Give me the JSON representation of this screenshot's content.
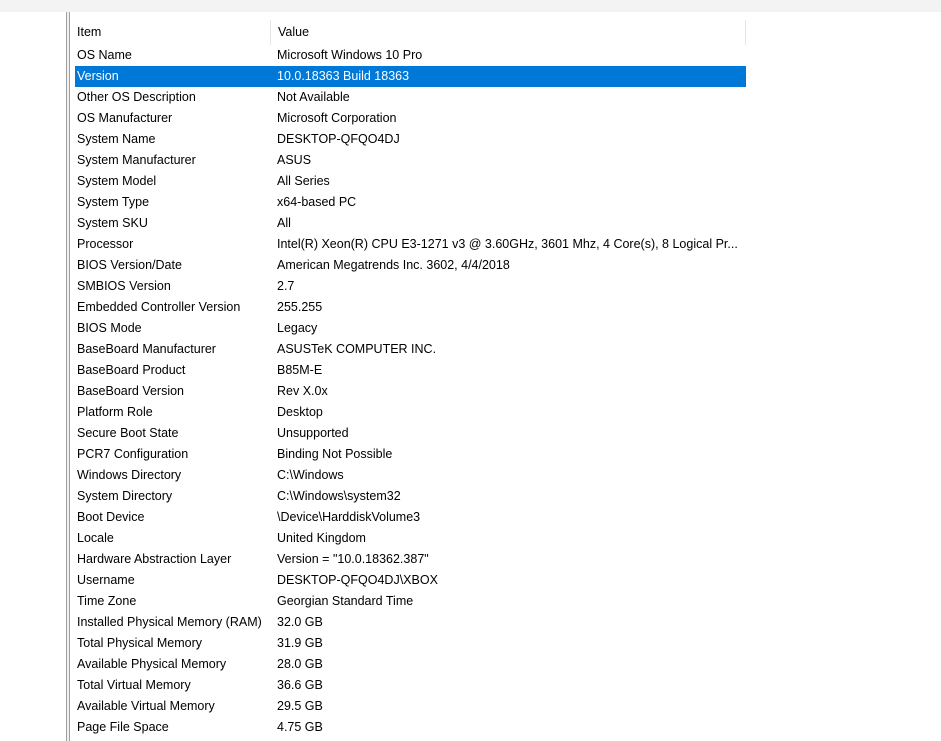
{
  "columns": {
    "item": "Item",
    "value": "Value"
  },
  "rows": [
    {
      "item": "OS Name",
      "value": "Microsoft Windows 10 Pro"
    },
    {
      "item": "Version",
      "value": "10.0.18363 Build 18363",
      "selected": true
    },
    {
      "item": "Other OS Description",
      "value": "Not Available"
    },
    {
      "item": "OS Manufacturer",
      "value": "Microsoft Corporation"
    },
    {
      "item": "System Name",
      "value": "DESKTOP-QFQO4DJ"
    },
    {
      "item": "System Manufacturer",
      "value": "ASUS"
    },
    {
      "item": "System Model",
      "value": "All Series"
    },
    {
      "item": "System Type",
      "value": "x64-based PC"
    },
    {
      "item": "System SKU",
      "value": "All"
    },
    {
      "item": "Processor",
      "value": "Intel(R) Xeon(R) CPU E3-1271 v3 @ 3.60GHz, 3601 Mhz, 4 Core(s), 8 Logical Pr..."
    },
    {
      "item": "BIOS Version/Date",
      "value": "American Megatrends Inc. 3602, 4/4/2018"
    },
    {
      "item": "SMBIOS Version",
      "value": "2.7"
    },
    {
      "item": "Embedded Controller Version",
      "value": "255.255"
    },
    {
      "item": "BIOS Mode",
      "value": "Legacy"
    },
    {
      "item": "BaseBoard Manufacturer",
      "value": "ASUSTeK COMPUTER INC."
    },
    {
      "item": "BaseBoard Product",
      "value": "B85M-E"
    },
    {
      "item": "BaseBoard Version",
      "value": "Rev X.0x"
    },
    {
      "item": "Platform Role",
      "value": "Desktop"
    },
    {
      "item": "Secure Boot State",
      "value": "Unsupported"
    },
    {
      "item": "PCR7 Configuration",
      "value": "Binding Not Possible"
    },
    {
      "item": "Windows Directory",
      "value": "C:\\Windows"
    },
    {
      "item": "System Directory",
      "value": "C:\\Windows\\system32"
    },
    {
      "item": "Boot Device",
      "value": "\\Device\\HarddiskVolume3"
    },
    {
      "item": "Locale",
      "value": "United Kingdom"
    },
    {
      "item": "Hardware Abstraction Layer",
      "value": "Version = \"10.0.18362.387\""
    },
    {
      "item": "Username",
      "value": "DESKTOP-QFQO4DJ\\XBOX"
    },
    {
      "item": "Time Zone",
      "value": "Georgian Standard Time"
    },
    {
      "item": "Installed Physical Memory (RAM)",
      "value": "32.0 GB"
    },
    {
      "item": "Total Physical Memory",
      "value": "31.9 GB"
    },
    {
      "item": "Available Physical Memory",
      "value": "28.0 GB"
    },
    {
      "item": "Total Virtual Memory",
      "value": "36.6 GB"
    },
    {
      "item": "Available Virtual Memory",
      "value": "29.5 GB"
    },
    {
      "item": "Page File Space",
      "value": "4.75 GB"
    }
  ],
  "colors": {
    "selection": "#0078d7",
    "selection_text": "#ffffff"
  }
}
